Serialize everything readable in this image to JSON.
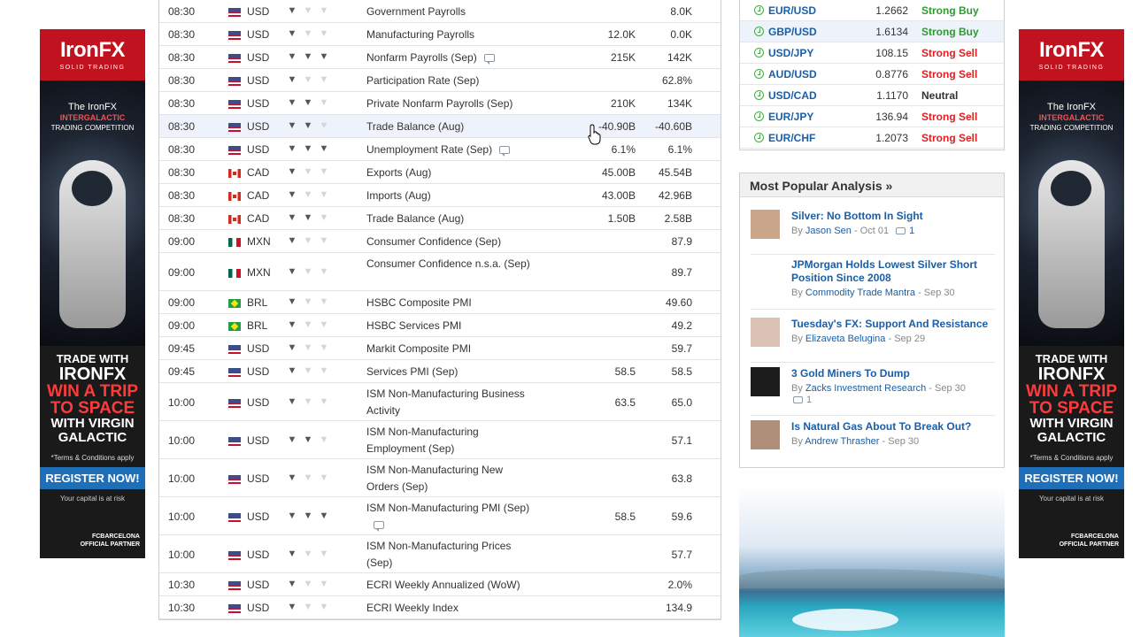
{
  "ads": {
    "brand": "IronFX",
    "tagline": "SOLID TRADING",
    "competition_line1": "The IronFX",
    "competition_line2": "INTERGALACTIC",
    "competition_line3": "TRADING COMPETITION",
    "trade_with": "TRADE WITH",
    "brand_caps": "IRONFX",
    "win_line1": "WIN A TRIP",
    "win_line2": "TO SPACE",
    "with_line1": "WITH VIRGIN",
    "with_line2": "GALACTIC",
    "terms": "*Terms & Conditions apply",
    "register": "REGISTER NOW!",
    "risk": "Your capital is at risk",
    "partner_line1": "FCBARCELONA",
    "partner_line2": "OFFICIAL PARTNER"
  },
  "calendar": {
    "rows": [
      {
        "time": "08:30",
        "flag": "us",
        "currency": "USD",
        "importance": 1,
        "event": "Government Payrolls",
        "forecast": "",
        "previous": "8.0K",
        "comment": false,
        "height": 26
      },
      {
        "time": "08:30",
        "flag": "us",
        "currency": "USD",
        "importance": 1,
        "event": "Manufacturing Payrolls",
        "forecast": "12.0K",
        "previous": "0.0K",
        "comment": false,
        "height": 26
      },
      {
        "time": "08:30",
        "flag": "us",
        "currency": "USD",
        "importance": 3,
        "event": "Nonfarm Payrolls (Sep)",
        "forecast": "215K",
        "previous": "142K",
        "comment": true,
        "height": 26
      },
      {
        "time": "08:30",
        "flag": "us",
        "currency": "USD",
        "importance": 1,
        "event": "Participation Rate (Sep)",
        "forecast": "",
        "previous": "62.8%",
        "comment": false,
        "height": 26
      },
      {
        "time": "08:30",
        "flag": "us",
        "currency": "USD",
        "importance": 2,
        "event": "Private Nonfarm Payrolls (Sep)",
        "forecast": "210K",
        "previous": "134K",
        "comment": false,
        "height": 26
      },
      {
        "time": "08:30",
        "flag": "us",
        "currency": "USD",
        "importance": 2,
        "event": "Trade Balance (Aug)",
        "forecast": "-40.90B",
        "previous": "-40.60B",
        "comment": false,
        "height": 26,
        "highlight": true
      },
      {
        "time": "08:30",
        "flag": "us",
        "currency": "USD",
        "importance": 3,
        "event": "Unemployment Rate (Sep)",
        "forecast": "6.1%",
        "previous": "6.1%",
        "comment": true,
        "height": 26
      },
      {
        "time": "08:30",
        "flag": "ca",
        "currency": "CAD",
        "importance": 1,
        "event": "Exports (Aug)",
        "forecast": "45.00B",
        "previous": "45.54B",
        "comment": false,
        "height": 26
      },
      {
        "time": "08:30",
        "flag": "ca",
        "currency": "CAD",
        "importance": 1,
        "event": "Imports (Aug)",
        "forecast": "43.00B",
        "previous": "42.96B",
        "comment": false,
        "height": 26
      },
      {
        "time": "08:30",
        "flag": "ca",
        "currency": "CAD",
        "importance": 2,
        "event": "Trade Balance (Aug)",
        "forecast": "1.50B",
        "previous": "2.58B",
        "comment": false,
        "height": 26
      },
      {
        "time": "09:00",
        "flag": "mx",
        "currency": "MXN",
        "importance": 1,
        "event": "Consumer Confidence (Sep)",
        "forecast": "",
        "previous": "87.9",
        "comment": false,
        "height": 26
      },
      {
        "time": "09:00",
        "flag": "mx",
        "currency": "MXN",
        "importance": 1,
        "event": "Consumer Confidence n.s.a. (Sep)",
        "forecast": "",
        "previous": "89.7",
        "comment": false,
        "height": 43
      },
      {
        "time": "09:00",
        "flag": "br",
        "currency": "BRL",
        "importance": 1,
        "event": "HSBC Composite PMI",
        "forecast": "",
        "previous": "49.60",
        "comment": false,
        "height": 26
      },
      {
        "time": "09:00",
        "flag": "br",
        "currency": "BRL",
        "importance": 1,
        "event": "HSBC Services PMI",
        "forecast": "",
        "previous": "49.2",
        "comment": false,
        "height": 26
      },
      {
        "time": "09:45",
        "flag": "us",
        "currency": "USD",
        "importance": 1,
        "event": "Markit Composite PMI",
        "forecast": "",
        "previous": "59.7",
        "comment": false,
        "height": 26
      },
      {
        "time": "09:45",
        "flag": "us",
        "currency": "USD",
        "importance": 1,
        "event": "Services PMI (Sep)",
        "forecast": "58.5",
        "previous": "58.5",
        "comment": false,
        "height": 26
      },
      {
        "time": "10:00",
        "flag": "us",
        "currency": "USD",
        "importance": 1,
        "event": "ISM Non-Manufacturing Business Activity",
        "forecast": "63.5",
        "previous": "65.0",
        "comment": false,
        "height": 43
      },
      {
        "time": "10:00",
        "flag": "us",
        "currency": "USD",
        "importance": 2,
        "event": "ISM Non-Manufacturing Employment (Sep)",
        "forecast": "",
        "previous": "57.1",
        "comment": false,
        "height": 43
      },
      {
        "time": "10:00",
        "flag": "us",
        "currency": "USD",
        "importance": 1,
        "event": "ISM Non-Manufacturing New Orders (Sep)",
        "forecast": "",
        "previous": "63.8",
        "comment": false,
        "height": 43
      },
      {
        "time": "10:00",
        "flag": "us",
        "currency": "USD",
        "importance": 3,
        "event": "ISM Non-Manufacturing PMI (Sep)",
        "forecast": "58.5",
        "previous": "59.6",
        "comment": true,
        "height": 43
      },
      {
        "time": "10:00",
        "flag": "us",
        "currency": "USD",
        "importance": 1,
        "event": "ISM Non-Manufacturing Prices (Sep)",
        "forecast": "",
        "previous": "57.7",
        "comment": false,
        "height": 43
      },
      {
        "time": "10:30",
        "flag": "us",
        "currency": "USD",
        "importance": 1,
        "event": "ECRI Weekly Annualized (WoW)",
        "forecast": "",
        "previous": "2.0%",
        "comment": false,
        "height": 26
      },
      {
        "time": "10:30",
        "flag": "us",
        "currency": "USD",
        "importance": 1,
        "event": "ECRI Weekly Index",
        "forecast": "",
        "previous": "134.9",
        "comment": false,
        "height": 26
      }
    ]
  },
  "signals": {
    "rows": [
      {
        "pair": "EUR/USD",
        "price": "1.2662",
        "signal": "Strong Buy",
        "color": "#2e9b2e",
        "highlight": false
      },
      {
        "pair": "GBP/USD",
        "price": "1.6134",
        "signal": "Strong Buy",
        "color": "#2e9b2e",
        "highlight": true
      },
      {
        "pair": "USD/JPY",
        "price": "108.15",
        "signal": "Strong Sell",
        "color": "#e02020",
        "highlight": false
      },
      {
        "pair": "AUD/USD",
        "price": "0.8776",
        "signal": "Strong Sell",
        "color": "#e02020",
        "highlight": false
      },
      {
        "pair": "USD/CAD",
        "price": "1.1170",
        "signal": "Neutral",
        "color": "#333333",
        "highlight": false
      },
      {
        "pair": "EUR/JPY",
        "price": "136.94",
        "signal": "Strong Sell",
        "color": "#e02020",
        "highlight": false
      },
      {
        "pair": "EUR/CHF",
        "price": "1.2073",
        "signal": "Strong Sell",
        "color": "#e02020",
        "highlight": false
      }
    ]
  },
  "popular": {
    "heading": "Most Popular Analysis »",
    "articles": [
      {
        "title": "Silver: No Bottom In Sight",
        "author": "Jason Sen",
        "date": "Oct 01",
        "comments": "1"
      },
      {
        "title": "JPMorgan Holds Lowest Silver Short Position Since 2008",
        "author": "Commodity Trade Mantra",
        "date": "Sep 30",
        "comments": ""
      },
      {
        "title": "Tuesday's FX: Support And Resistance",
        "author": "Elizaveta Belugina",
        "date": "Sep 29",
        "comments": ""
      },
      {
        "title": "3 Gold Miners To Dump",
        "author": "Zacks Investment Research",
        "date": "Sep 30",
        "comments": "1"
      },
      {
        "title": "Is Natural Gas About To Break Out?",
        "author": "Andrew Thrasher",
        "date": "Sep 30",
        "comments": ""
      }
    ]
  },
  "meta_labels": {
    "by": "By",
    "dash": " - "
  }
}
